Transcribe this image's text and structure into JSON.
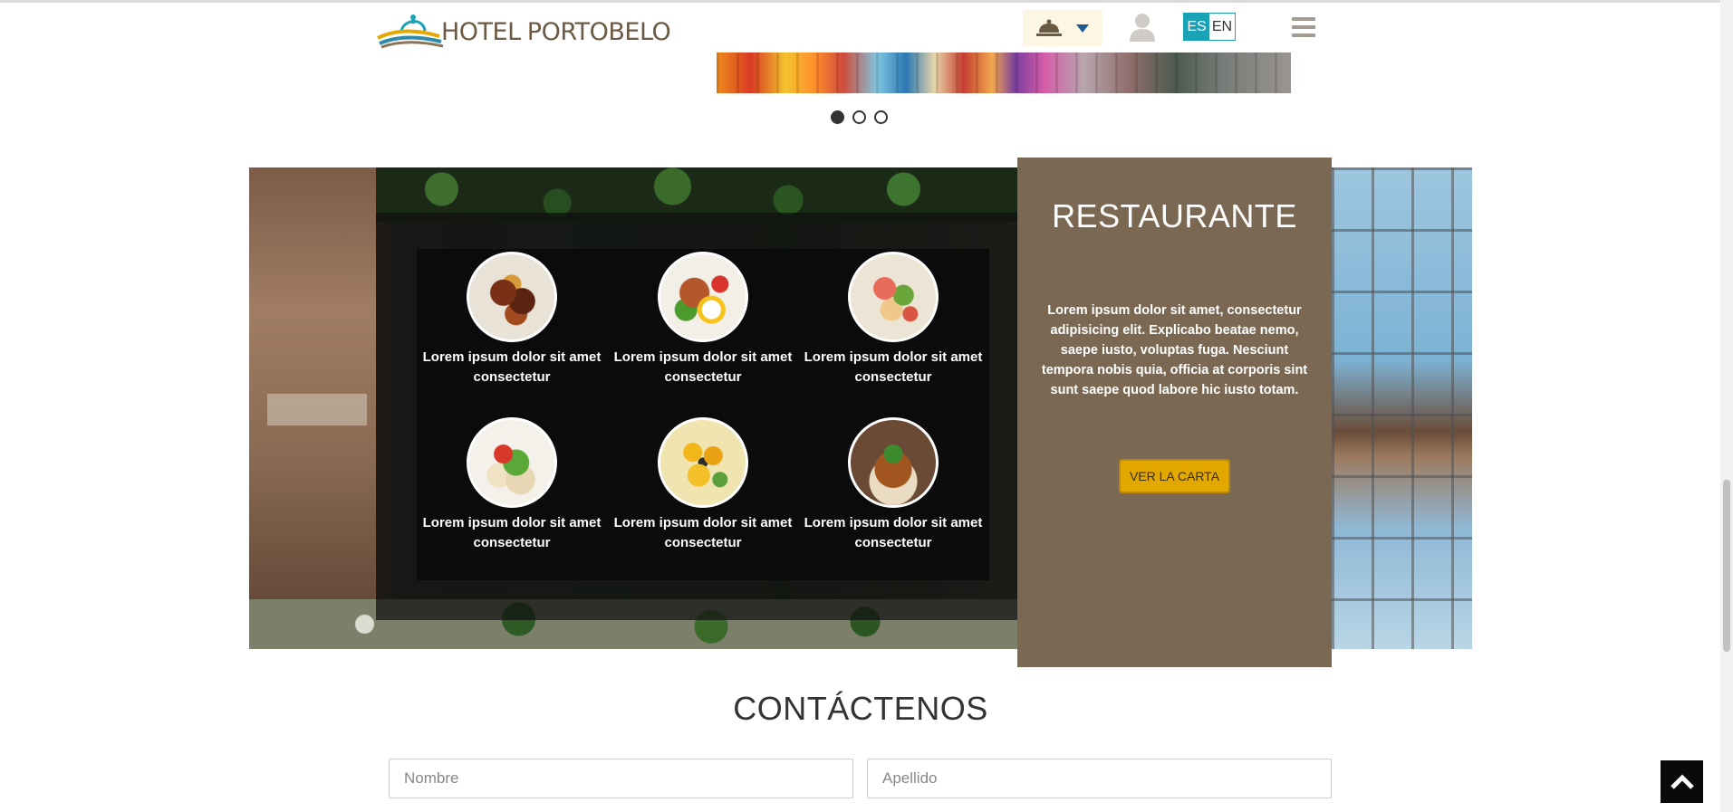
{
  "header": {
    "logo_text_hotel": "HOTEL",
    "logo_text_name": "PORTOBELO",
    "service_icon": "service-bell-icon",
    "dropdown_icon": "caret-down-icon",
    "user_icon": "user-icon",
    "lang_es": "ES",
    "lang_en": "EN",
    "menu_icon": "hamburger-menu-icon",
    "colors": {
      "accent": "#1aa3b7",
      "brand_brown": "#6b5a44",
      "service_bg": "#fcf6e4"
    }
  },
  "slider": {
    "dots": [
      {
        "active": true
      },
      {
        "active": false
      },
      {
        "active": false
      }
    ]
  },
  "restaurant": {
    "title": "RESTAURANTE",
    "description": "Lorem ipsum dolor sit amet, consectetur adipisicing elit. Explicabo beatae nemo, saepe iusto, voluptas fuga. Nesciunt tempora nobis quia, officia at corporis sint sunt saepe quod labore hic iusto totam.",
    "button": "VER LA CARTA",
    "panel_color": "#7b6853",
    "button_color": "#e3a800",
    "dishes": [
      {
        "caption": "Lorem ipsum dolor sit amet consectetur"
      },
      {
        "caption": "Lorem ipsum dolor sit amet consectetur"
      },
      {
        "caption": "Lorem ipsum dolor sit amet consectetur"
      },
      {
        "caption": "Lorem ipsum dolor sit amet consectetur"
      },
      {
        "caption": "Lorem ipsum dolor sit amet consectetur"
      },
      {
        "caption": "Lorem ipsum dolor sit amet consectetur"
      }
    ]
  },
  "contact": {
    "title": "CONTÁCTENOS",
    "first_name_placeholder": "Nombre",
    "last_name_placeholder": "Apellido"
  },
  "scroll_top_icon": "chevron-up-icon"
}
